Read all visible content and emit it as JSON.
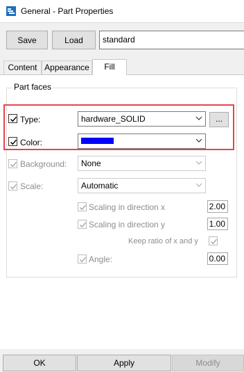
{
  "window": {
    "title": "General - Part Properties"
  },
  "toolbar": {
    "save_label": "Save",
    "load_label": "Load",
    "preset_value": "standard"
  },
  "tabs": [
    {
      "label": "Content"
    },
    {
      "label": "Appearance"
    },
    {
      "label": "Fill"
    }
  ],
  "active_tab": "Fill",
  "part_faces": {
    "group_label": "Part faces",
    "type": {
      "label": "Type:",
      "checked": true,
      "value": "hardware_SOLID",
      "browse_label": "..."
    },
    "color": {
      "label": "Color:",
      "checked": true,
      "value_color": "#0000ff"
    },
    "background": {
      "label": "Background:",
      "checked": true,
      "enabled": false,
      "value": "None"
    },
    "scale": {
      "label": "Scale:",
      "checked": true,
      "enabled": false,
      "value": "Automatic"
    },
    "scale_x": {
      "label": "Scaling in direction x",
      "checked": true,
      "enabled": false,
      "value": "2.00"
    },
    "scale_y": {
      "label": "Scaling in direction y",
      "checked": true,
      "enabled": false,
      "value": "1.00"
    },
    "keep_ratio": {
      "label": "Keep ratio of x and y",
      "checked": true,
      "enabled": false
    },
    "angle": {
      "label": "Angle:",
      "checked": true,
      "enabled": false,
      "value": "0.00"
    }
  },
  "footer": {
    "ok_label": "OK",
    "apply_label": "Apply",
    "modify_label": "Modify"
  },
  "colors": {
    "highlight": "#e0474c",
    "swatch": "#0000ff",
    "accent": "#1e6fbf"
  }
}
